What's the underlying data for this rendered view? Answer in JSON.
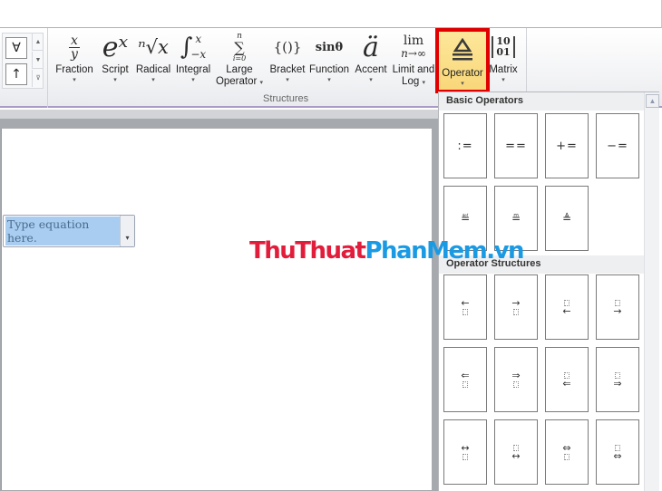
{
  "symbol_gallery": {
    "items": [
      "∀",
      "↑"
    ],
    "scroll_up": "▲",
    "scroll_down": "▼",
    "more": "⊽"
  },
  "ribbon": {
    "buttons": [
      {
        "label": "Fraction",
        "label2": "",
        "icon": "fraction-icon",
        "has_arrow": true
      },
      {
        "label": "Script",
        "label2": "",
        "icon": "script-icon",
        "has_arrow": true
      },
      {
        "label": "Radical",
        "label2": "",
        "icon": "radical-icon",
        "has_arrow": true
      },
      {
        "label": "Integral",
        "label2": "",
        "icon": "integral-icon",
        "has_arrow": true
      },
      {
        "label": "Large",
        "label2": "Operator",
        "icon": "large-operator-icon",
        "has_arrow": true
      },
      {
        "label": "Bracket",
        "label2": "",
        "icon": "bracket-icon",
        "has_arrow": true
      },
      {
        "label": "Function",
        "label2": "",
        "icon": "function-icon",
        "has_arrow": true
      },
      {
        "label": "Accent",
        "label2": "",
        "icon": "accent-icon",
        "has_arrow": true
      },
      {
        "label": "Limit and",
        "label2": "Log",
        "icon": "limit-log-icon",
        "has_arrow": true
      },
      {
        "label": "Operator",
        "label2": "",
        "icon": "operator-icon",
        "has_arrow": true,
        "highlighted": true
      },
      {
        "label": "Matrix",
        "label2": "",
        "icon": "matrix-icon",
        "has_arrow": true
      }
    ],
    "glyphs": {
      "fraction_num": "x",
      "fraction_den": "y",
      "script": "eˣ",
      "radical": "ⁿ√x",
      "integral": "∫",
      "integral_upper": "x",
      "integral_lower": "−x",
      "large_operator": "∑",
      "large_operator_upper": "n",
      "large_operator_lower": "i=0",
      "bracket": "{()}",
      "function": "sinθ",
      "accent": "ä",
      "limit_top": "lim",
      "limit_bottom": "n→∞",
      "operator": "≜",
      "matrix": "[1 0 / 0 1]",
      "matrix_row1": "10",
      "matrix_row2": "01"
    },
    "arrow": "▾",
    "group_label": "Structures"
  },
  "document": {
    "equation_placeholder": "Type equation here.",
    "equation_dropdown": "▾"
  },
  "operator_gallery": {
    "scroll_up": "▲",
    "sections": [
      {
        "title": "Basic Operators",
        "items": [
          {
            "name": "colon-equals",
            "symbol": ":="
          },
          {
            "name": "double-equals",
            "symbol": "=="
          },
          {
            "name": "plus-equals",
            "symbol": "+="
          },
          {
            "name": "minus-equals",
            "symbol": "−="
          },
          {
            "name": "equal-by-definition",
            "symbol": "≝"
          },
          {
            "name": "measured-by",
            "symbol": "≞"
          },
          {
            "name": "delta-equal-to",
            "symbol": "≜"
          }
        ]
      },
      {
        "title": "Operator Structures",
        "items": [
          {
            "name": "left-arrow-below",
            "arrow": "←",
            "position": "top"
          },
          {
            "name": "right-arrow-below",
            "arrow": "→",
            "position": "top"
          },
          {
            "name": "left-arrow-above",
            "arrow": "←",
            "position": "bottom"
          },
          {
            "name": "right-arrow-above",
            "arrow": "→",
            "position": "bottom"
          },
          {
            "name": "double-left-arrow-below",
            "arrow": "⇐",
            "position": "top"
          },
          {
            "name": "double-right-arrow-below",
            "arrow": "⇒",
            "position": "top"
          },
          {
            "name": "double-left-arrow-above",
            "arrow": "⇐",
            "position": "bottom"
          },
          {
            "name": "double-right-arrow-above",
            "arrow": "⇒",
            "position": "bottom"
          },
          {
            "name": "left-right-arrow-below",
            "arrow": "↔",
            "position": "top"
          },
          {
            "name": "left-right-arrow-above",
            "arrow": "↔",
            "position": "bottom"
          },
          {
            "name": "double-left-right-arrow-below",
            "arrow": "⇔",
            "position": "top"
          },
          {
            "name": "double-left-right-arrow-above",
            "arrow": "⇔",
            "position": "bottom"
          }
        ]
      }
    ]
  },
  "watermark": {
    "part1": "ThuThuat",
    "part2": "PhanMem.vn"
  },
  "colors": {
    "highlight_border": "#e00000",
    "highlight_fill": "#fbdc82",
    "equation_selection": "#a8cdf0",
    "watermark_red": "#e21d3c",
    "watermark_blue": "#1b9ae4"
  }
}
